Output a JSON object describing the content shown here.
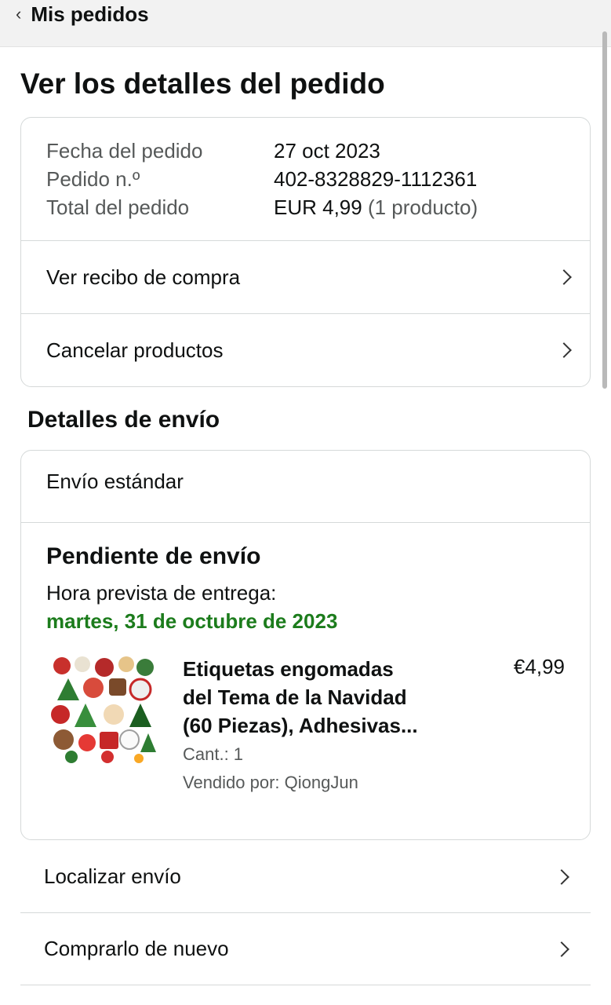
{
  "header": {
    "back_label": "Mis pedidos"
  },
  "page_title": "Ver los detalles del pedido",
  "order_summary": {
    "rows": [
      {
        "label": "Fecha del pedido",
        "value": "27 oct 2023"
      },
      {
        "label": "Pedido n.º",
        "value": "402-8328829-1112361"
      },
      {
        "label": "Total del pedido",
        "value": "EUR 4,99",
        "extra": "(1 producto)"
      }
    ]
  },
  "order_actions": [
    {
      "label": "Ver recibo de compra"
    },
    {
      "label": "Cancelar productos"
    }
  ],
  "shipping": {
    "section_title": "Detalles de envío",
    "type": "Envío estándar",
    "status": "Pendiente de envío",
    "eta_label": "Hora prevista de entrega:",
    "eta_date": "martes, 31 de octubre de 2023",
    "status_color": "#1c7c1c"
  },
  "product": {
    "title_line1": "Etiquetas engomadas",
    "title_line2": "del Tema de la Navidad",
    "title_line3": "(60 Piezas), Adhesivas...",
    "price": "€4,99",
    "quantity": "Cant.: 1",
    "seller": "Vendido por: QiongJun"
  },
  "shipment_actions": [
    {
      "label": "Localizar envío"
    },
    {
      "label": "Comprarlo de nuevo"
    }
  ]
}
